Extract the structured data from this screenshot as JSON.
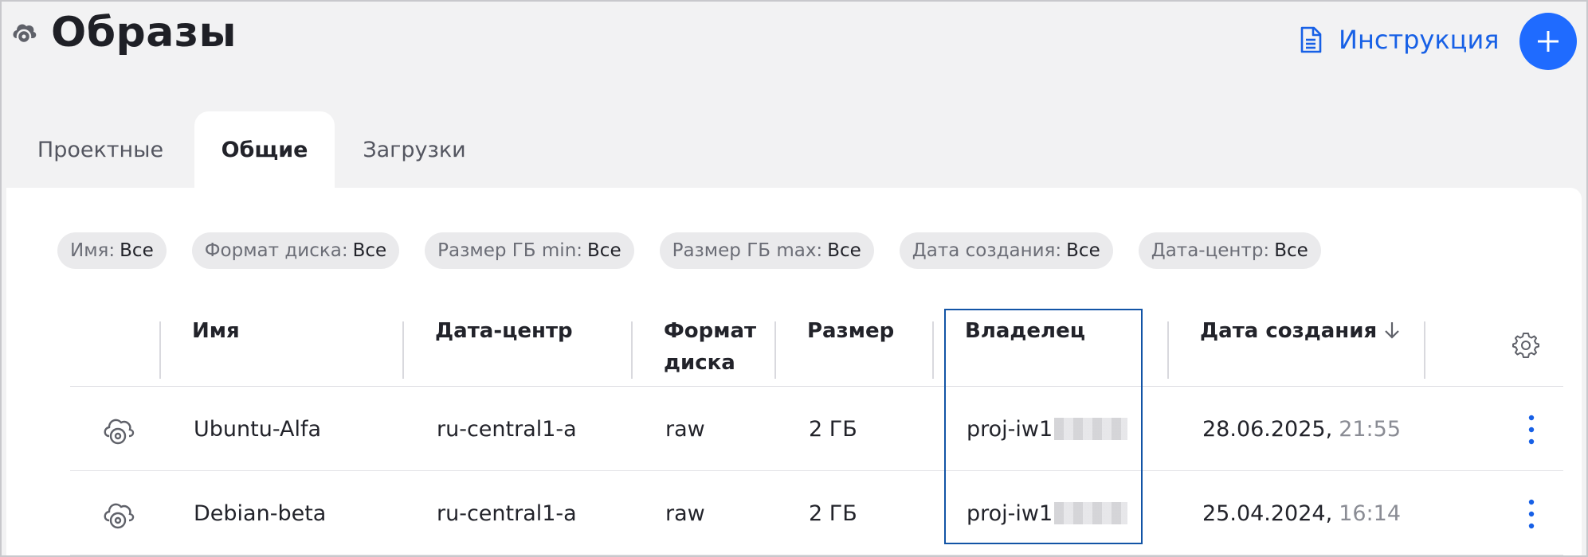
{
  "header": {
    "title": "Образы",
    "docs_label": "Инструкция",
    "page_icon": "disk-image-icon",
    "docs_icon": "document-icon",
    "add_icon": "plus-icon"
  },
  "tabs": [
    {
      "label": "Проектные",
      "active": false
    },
    {
      "label": "Общие",
      "active": true
    },
    {
      "label": "Загрузки",
      "active": false
    }
  ],
  "filters": [
    {
      "label": "Имя:",
      "value": "Все"
    },
    {
      "label": "Формат диска:",
      "value": "Все"
    },
    {
      "label": "Размер ГБ min:",
      "value": "Все"
    },
    {
      "label": "Размер ГБ max:",
      "value": "Все"
    },
    {
      "label": "Дата создания:",
      "value": "Все"
    },
    {
      "label": "Дата-центр:",
      "value": "Все"
    }
  ],
  "table": {
    "columns": {
      "name": "Имя",
      "datacenter": "Дата-центр",
      "format_line1": "Формат",
      "format_line2": "диска",
      "size": "Размер",
      "owner": "Владелец",
      "created": "Дата создания"
    },
    "rows": [
      {
        "name": "Ubuntu-Alfa",
        "datacenter": "ru-central1-a",
        "format": "raw",
        "size": "2 ГБ",
        "owner": "proj-iw1",
        "date": "28.06.2025,",
        "time": "21:55"
      },
      {
        "name": "Debian-beta",
        "datacenter": "ru-central1-a",
        "format": "raw",
        "size": "2 ГБ",
        "owner": "proj-iw1",
        "date": "25.04.2024,",
        "time": "16:14"
      }
    ]
  },
  "colors": {
    "accent": "#1f6bff",
    "link": "#1760e6",
    "highlight_border": "#1254a6",
    "background": "#f2f2f3"
  }
}
